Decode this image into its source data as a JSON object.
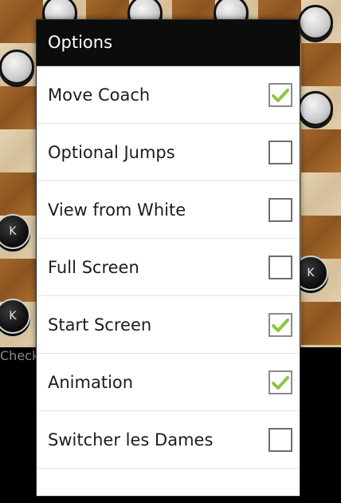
{
  "background": {
    "footer_label": "Check"
  },
  "dialog": {
    "title": "Options",
    "items": [
      {
        "label": "Move Coach",
        "checked": true
      },
      {
        "label": "Optional Jumps",
        "checked": false
      },
      {
        "label": "View from White",
        "checked": false
      },
      {
        "label": "Full Screen",
        "checked": false
      },
      {
        "label": "Start Screen",
        "checked": true
      },
      {
        "label": "Animation",
        "checked": true
      },
      {
        "label": "Switcher les Dames",
        "checked": false
      }
    ]
  },
  "colors": {
    "dialog_header": "#0c0c0c",
    "check_mark": "#8dc63f",
    "board_light": "#e0cba8",
    "board_dark": "#9a5f26"
  },
  "pieces": {
    "king_symbol": "K"
  }
}
